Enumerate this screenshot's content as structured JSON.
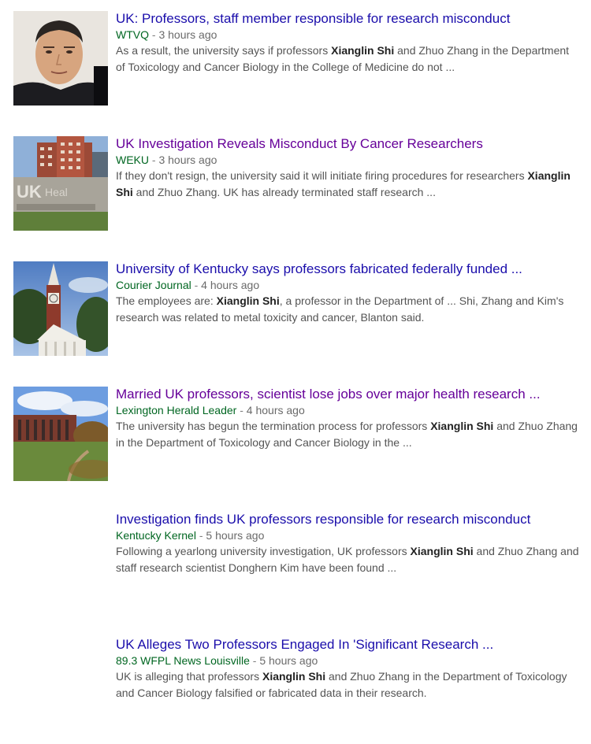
{
  "colors": {
    "link": "#1a0dab",
    "visited": "#660099",
    "source": "#006621",
    "snippet": "#545454"
  },
  "results": [
    {
      "thumbnail": "person-portrait",
      "title": "UK: Professors, staff member responsible for research misconduct",
      "title_color": "#1a0dab",
      "source": "WTVQ",
      "sep": " - ",
      "time": "3 hours ago",
      "snippet": [
        {
          "text": "As a result, the university says if professors ",
          "bold": false
        },
        {
          "text": "Xianglin Shi",
          "bold": true
        },
        {
          "text": " and Zhuo Zhang in the Department of Toxicology and Cancer Biology in the College of Medicine do not ...",
          "bold": false
        }
      ]
    },
    {
      "thumbnail": "uk-healthcare-sign",
      "title": "UK Investigation Reveals Misconduct By Cancer Researchers",
      "title_color": "#660099",
      "source": "WEKU",
      "sep": " - ",
      "time": "3 hours ago",
      "snippet": [
        {
          "text": "If they don't resign, the university said it will initiate firing procedures for researchers ",
          "bold": false
        },
        {
          "text": "Xianglin Shi",
          "bold": true
        },
        {
          "text": " and Zhuo Zhang. UK has already terminated staff research ...",
          "bold": false
        }
      ]
    },
    {
      "thumbnail": "clock-tower-building",
      "title": "University of Kentucky says professors fabricated federally funded ...",
      "title_color": "#1a0dab",
      "source": "Courier Journal",
      "sep": " - ",
      "time": "4 hours ago",
      "snippet": [
        {
          "text": "The employees are: ",
          "bold": false
        },
        {
          "text": "Xianglin Shi",
          "bold": true
        },
        {
          "text": ", a professor in the Department of ... Shi, Zhang and Kim's research was related to metal toxicity and cancer, Blanton said.",
          "bold": false
        }
      ]
    },
    {
      "thumbnail": "campus-building-lawn",
      "title": "Married UK professors, scientist lose jobs over major health research ...",
      "title_color": "#660099",
      "source": "Lexington Herald Leader",
      "sep": " - ",
      "time": "4 hours ago",
      "snippet": [
        {
          "text": "The university has begun the termination process for professors ",
          "bold": false
        },
        {
          "text": "Xianglin Shi",
          "bold": true
        },
        {
          "text": " and Zhuo Zhang in the Department of Toxicology and Cancer Biology in the ...",
          "bold": false
        }
      ]
    },
    {
      "thumbnail": "",
      "title": "Investigation finds UK professors responsible for research misconduct",
      "title_color": "#1a0dab",
      "source": "Kentucky Kernel",
      "sep": " - ",
      "time": "5 hours ago",
      "snippet": [
        {
          "text": "Following a yearlong university investigation, UK professors ",
          "bold": false
        },
        {
          "text": "Xianglin Shi",
          "bold": true
        },
        {
          "text": " and Zhuo Zhang and staff research scientist Donghern Kim have been found ...",
          "bold": false
        }
      ]
    },
    {
      "thumbnail": "",
      "title": "UK Alleges Two Professors Engaged In 'Significant Research ...",
      "title_color": "#1a0dab",
      "source": "89.3 WFPL News Louisville",
      "sep": " - ",
      "time": "5 hours ago",
      "snippet": [
        {
          "text": "UK is alleging that professors ",
          "bold": false
        },
        {
          "text": "Xianglin Shi",
          "bold": true
        },
        {
          "text": " and Zhuo Zhang in the Department of Toxicology and Cancer Biology falsified or fabricated data in their research.",
          "bold": false
        }
      ]
    }
  ]
}
